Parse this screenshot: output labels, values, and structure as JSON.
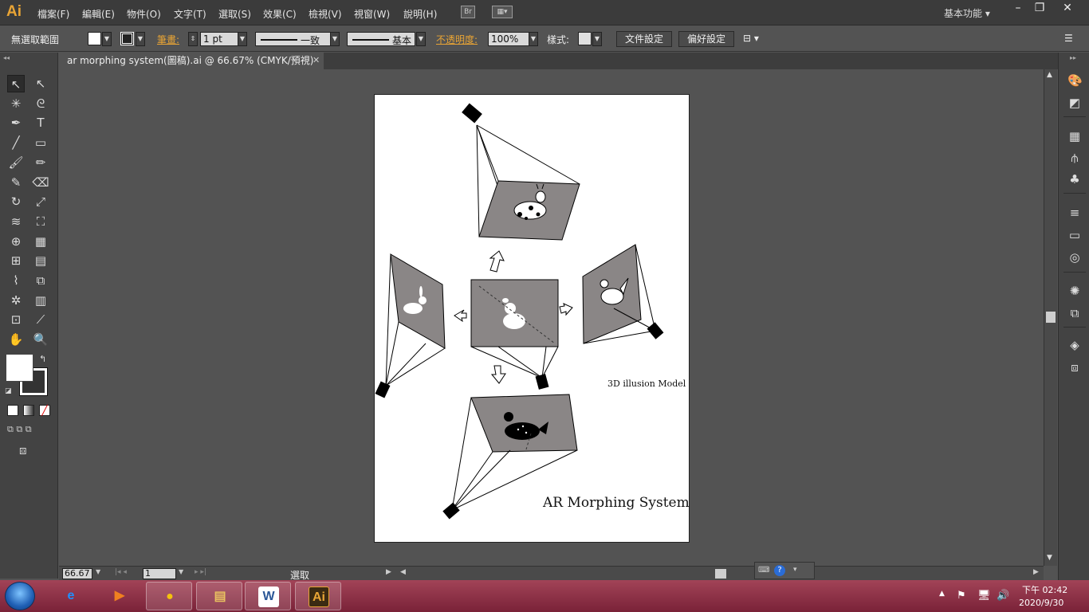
{
  "app": {
    "logo": "Ai",
    "workspace": "基本功能",
    "bridge_icon": "Br"
  },
  "menu": [
    {
      "label": "檔案(F)"
    },
    {
      "label": "編輯(E)"
    },
    {
      "label": "物件(O)"
    },
    {
      "label": "文字(T)"
    },
    {
      "label": "選取(S)"
    },
    {
      "label": "效果(C)"
    },
    {
      "label": "檢視(V)"
    },
    {
      "label": "視窗(W)"
    },
    {
      "label": "說明(H)"
    }
  ],
  "window_controls": {
    "minimize": "–",
    "restore": "❐",
    "close": "✕"
  },
  "control_bar": {
    "selection": "無選取範圍",
    "stroke_label": "筆畫:",
    "stroke_weight": "1 pt",
    "stroke_profile": "一致",
    "brush": "基本",
    "opacity_label": "不透明度:",
    "opacity_value": "100%",
    "style_label": "樣式:",
    "doc_setup": "文件設定",
    "preferences": "偏好設定"
  },
  "document_tab": {
    "title": "ar morphing system(圖稿).ai @ 66.67% (CMYK/預視)",
    "close": "✕"
  },
  "artwork": {
    "label_model": "3D illusion Model",
    "label_title": "AR Morphing System"
  },
  "status_bar": {
    "zoom": "66.67",
    "artboard_number": "1",
    "tool_status": "選取"
  },
  "tools": [
    {
      "name": "selection-tool-icon",
      "glyph": "↖"
    },
    {
      "name": "direct-selection-tool-icon",
      "glyph": "↖"
    },
    {
      "name": "magic-wand-tool-icon",
      "glyph": "✳"
    },
    {
      "name": "lasso-tool-icon",
      "glyph": "ᘓ"
    },
    {
      "name": "pen-tool-icon",
      "glyph": "✒"
    },
    {
      "name": "type-tool-icon",
      "glyph": "T"
    },
    {
      "name": "line-tool-icon",
      "glyph": "╱"
    },
    {
      "name": "rectangle-tool-icon",
      "glyph": "▭"
    },
    {
      "name": "paintbrush-tool-icon",
      "glyph": "🖌"
    },
    {
      "name": "pencil-tool-icon",
      "glyph": "✏"
    },
    {
      "name": "blob-brush-tool-icon",
      "glyph": "✎"
    },
    {
      "name": "eraser-tool-icon",
      "glyph": "⌫"
    },
    {
      "name": "rotate-tool-icon",
      "glyph": "↻"
    },
    {
      "name": "scale-tool-icon",
      "glyph": "⤢"
    },
    {
      "name": "warp-tool-icon",
      "glyph": "≋"
    },
    {
      "name": "free-transform-tool-icon",
      "glyph": "⛶"
    },
    {
      "name": "shape-builder-tool-icon",
      "glyph": "⊕"
    },
    {
      "name": "perspective-grid-tool-icon",
      "glyph": "▦"
    },
    {
      "name": "mesh-tool-icon",
      "glyph": "⊞"
    },
    {
      "name": "gradient-tool-icon",
      "glyph": "▤"
    },
    {
      "name": "eyedropper-tool-icon",
      "glyph": "⌇"
    },
    {
      "name": "blend-tool-icon",
      "glyph": "⧉"
    },
    {
      "name": "symbol-sprayer-tool-icon",
      "glyph": "✲"
    },
    {
      "name": "column-graph-tool-icon",
      "glyph": "▥"
    },
    {
      "name": "artboard-tool-icon",
      "glyph": "⊡"
    },
    {
      "name": "slice-tool-icon",
      "glyph": "⟋"
    },
    {
      "name": "hand-tool-icon",
      "glyph": "✋"
    },
    {
      "name": "zoom-tool-icon",
      "glyph": "🔍"
    }
  ],
  "taskbar": {
    "clock_time": "下午 02:42",
    "clock_date": "2020/9/30",
    "apps": [
      {
        "name": "ie",
        "glyph": "e",
        "color": "#1e90ff"
      },
      {
        "name": "media-player",
        "glyph": "▶",
        "color": "#f08020"
      },
      {
        "name": "chrome",
        "glyph": "●",
        "color": "#f4c20d"
      },
      {
        "name": "file-explorer",
        "glyph": "▤",
        "color": "#e8c060"
      },
      {
        "name": "word",
        "glyph": "W",
        "color": "#2b5797"
      },
      {
        "name": "illustrator",
        "glyph": "Ai",
        "color": "#e8a435"
      }
    ]
  },
  "colors": {
    "accent": "#e8a435",
    "panel_bg": "#535353",
    "taskbar": "#8a2a40"
  }
}
